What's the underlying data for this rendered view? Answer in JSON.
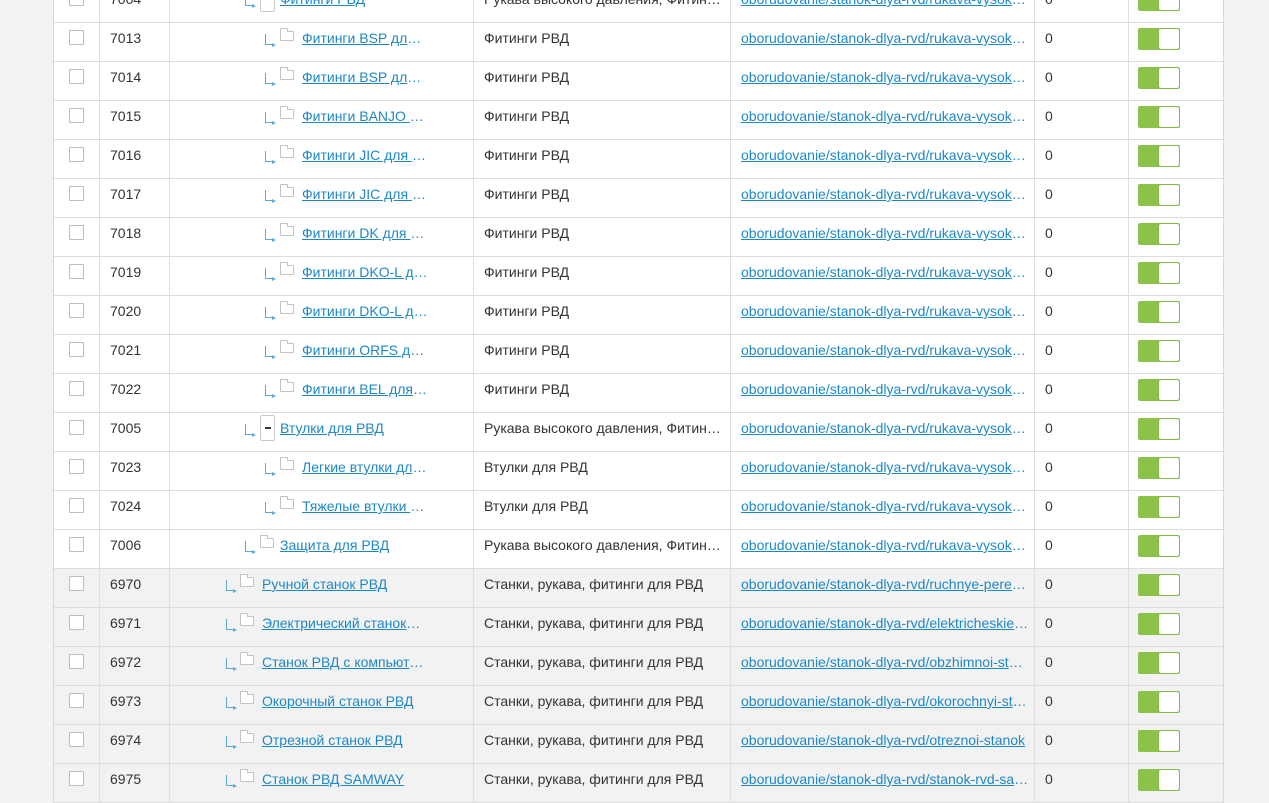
{
  "accent_color": "#8bc34a",
  "link_color": "#1e88c7",
  "rows": [
    {
      "id": "7004",
      "name": "Фитинги РВД",
      "parent": "Рукава высокого давления, Фитинги РВД",
      "url": "oborudovanie/stanok-dlya-rvd/rukava-vysokogo-davleniya",
      "count": "0",
      "level": 2,
      "expand": true,
      "grey": false
    },
    {
      "id": "7013",
      "name": "Фитинги BSP для РВД",
      "parent": "Фитинги РВД",
      "url": "oborudovanie/stanok-dlya-rvd/rukava-vysokogo-davleniya",
      "count": "0",
      "level": 3,
      "expand": false,
      "grey": false
    },
    {
      "id": "7014",
      "name": "Фитинги BSP для РВД",
      "parent": "Фитинги РВД",
      "url": "oborudovanie/stanok-dlya-rvd/rukava-vysokogo-davleniya",
      "count": "0",
      "level": 3,
      "expand": false,
      "grey": false
    },
    {
      "id": "7015",
      "name": "Фитинги BANJO для РВД",
      "parent": "Фитинги РВД",
      "url": "oborudovanie/stanok-dlya-rvd/rukava-vysokogo-davleniya",
      "count": "0",
      "level": 3,
      "expand": false,
      "grey": false
    },
    {
      "id": "7016",
      "name": "Фитинги JIC для РВД",
      "parent": "Фитинги РВД",
      "url": "oborudovanie/stanok-dlya-rvd/rukava-vysokogo-davleniya",
      "count": "0",
      "level": 3,
      "expand": false,
      "grey": false
    },
    {
      "id": "7017",
      "name": "Фитинги JIC для РВД",
      "parent": "Фитинги РВД",
      "url": "oborudovanie/stanok-dlya-rvd/rukava-vysokogo-davleniya",
      "count": "0",
      "level": 3,
      "expand": false,
      "grey": false
    },
    {
      "id": "7018",
      "name": "Фитинги DK для РВД",
      "parent": "Фитинги РВД",
      "url": "oborudovanie/stanok-dlya-rvd/rukava-vysokogo-davleniya",
      "count": "0",
      "level": 3,
      "expand": false,
      "grey": false
    },
    {
      "id": "7019",
      "name": "Фитинги DKO-L для РВД",
      "parent": "Фитинги РВД",
      "url": "oborudovanie/stanok-dlya-rvd/rukava-vysokogo-davleniya",
      "count": "0",
      "level": 3,
      "expand": false,
      "grey": false
    },
    {
      "id": "7020",
      "name": "Фитинги DKO-L для РВД",
      "parent": "Фитинги РВД",
      "url": "oborudovanie/stanok-dlya-rvd/rukava-vysokogo-davleniya",
      "count": "0",
      "level": 3,
      "expand": false,
      "grey": false
    },
    {
      "id": "7021",
      "name": "Фитинги ORFS для РВД",
      "parent": "Фитинги РВД",
      "url": "oborudovanie/stanok-dlya-rvd/rukava-vysokogo-davleniya",
      "count": "0",
      "level": 3,
      "expand": false,
      "grey": false
    },
    {
      "id": "7022",
      "name": "Фитинги BEL для РВД",
      "parent": "Фитинги РВД",
      "url": "oborudovanie/stanok-dlya-rvd/rukava-vysokogo-davleniya",
      "count": "0",
      "level": 3,
      "expand": false,
      "grey": false
    },
    {
      "id": "7005",
      "name": "Втулки для РВД",
      "parent": "Рукава высокого давления, Фитинги РВД",
      "url": "oborudovanie/stanok-dlya-rvd/rukava-vysokogo-davleniya",
      "count": "0",
      "level": 2,
      "expand": true,
      "grey": false
    },
    {
      "id": "7023",
      "name": "Легкие втулки для РВД",
      "parent": "Втулки для РВД",
      "url": "oborudovanie/stanok-dlya-rvd/rukava-vysokogo-davleniya",
      "count": "0",
      "level": 3,
      "expand": false,
      "grey": false
    },
    {
      "id": "7024",
      "name": "Тяжелые втулки для РВД",
      "parent": "Втулки для РВД",
      "url": "oborudovanie/stanok-dlya-rvd/rukava-vysokogo-davleniya",
      "count": "0",
      "level": 3,
      "expand": false,
      "grey": false
    },
    {
      "id": "7006",
      "name": "Защита для РВД",
      "parent": "Рукава высокого давления, Фитинги РВД",
      "url": "oborudovanie/stanok-dlya-rvd/rukava-vysokogo-davleniya",
      "count": "0",
      "level": 2,
      "expand": false,
      "grey": false
    },
    {
      "id": "6970",
      "name": "Ручной станок РВД",
      "parent": "Станки, рукава, фитинги для РВД",
      "url": "oborudovanie/stanok-dlya-rvd/ruchnye-perenosnye-stanki",
      "count": "0",
      "level": 1,
      "expand": false,
      "grey": true
    },
    {
      "id": "6971",
      "name": "Электрический станок РВД",
      "parent": "Станки, рукава, фитинги для РВД",
      "url": "oborudovanie/stanok-dlya-rvd/elektricheskie-stanki",
      "count": "0",
      "level": 1,
      "expand": false,
      "grey": true
    },
    {
      "id": "6972",
      "name": "Станок РВД с компьютером",
      "parent": "Станки, рукава, фитинги для РВД",
      "url": "oborudovanie/stanok-dlya-rvd/obzhimnoi-stanok",
      "count": "0",
      "level": 1,
      "expand": false,
      "grey": true
    },
    {
      "id": "6973",
      "name": "Окорочный станок РВД",
      "parent": "Станки, рукава, фитинги для РВД",
      "url": "oborudovanie/stanok-dlya-rvd/okorochnyi-stanok",
      "count": "0",
      "level": 1,
      "expand": false,
      "grey": true
    },
    {
      "id": "6974",
      "name": "Отрезной станок РВД",
      "parent": "Станки, рукава, фитинги для РВД",
      "url": "oborudovanie/stanok-dlya-rvd/otreznoi-stanok",
      "count": "0",
      "level": 1,
      "expand": false,
      "grey": true
    },
    {
      "id": "6975",
      "name": "Станок РВД SAMWAY",
      "parent": "Станки, рукава, фитинги для РВД",
      "url": "oborudovanie/stanok-dlya-rvd/stanok-rvd-samway",
      "count": "0",
      "level": 1,
      "expand": false,
      "grey": true
    }
  ]
}
